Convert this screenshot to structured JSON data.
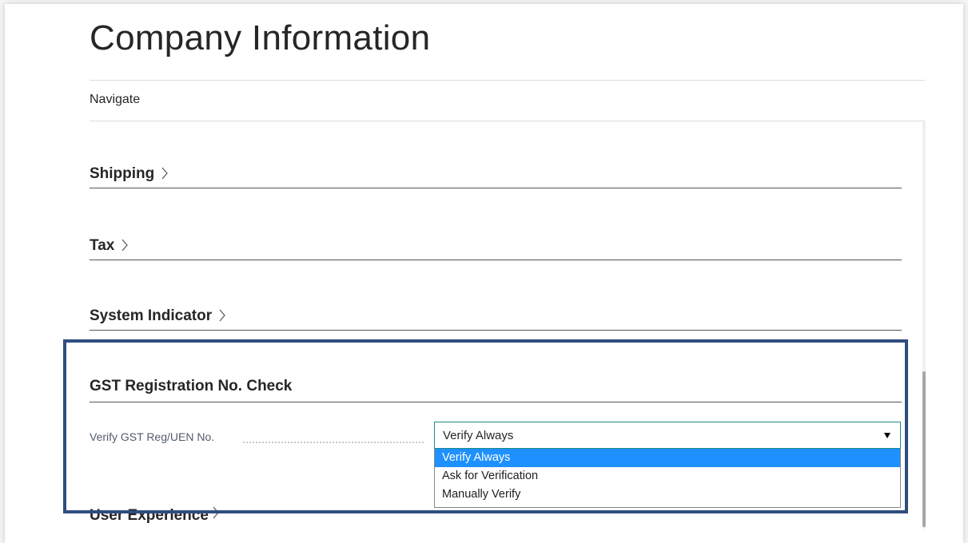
{
  "page": {
    "title": "Company Information"
  },
  "navigation": {
    "navigate_label": "Navigate"
  },
  "fasttabs": [
    {
      "label": "Shipping",
      "icon": "chevron-right-icon"
    },
    {
      "label": "Tax",
      "icon": "chevron-right-icon"
    },
    {
      "label": "System Indicator",
      "icon": "chevron-right-icon"
    }
  ],
  "gst_section": {
    "title": "GST Registration No. Check",
    "field_label": "Verify GST Reg/UEN No.",
    "selected_value": "Verify Always",
    "options": [
      "Verify Always",
      "Ask for Verification",
      "Manually Verify"
    ]
  },
  "user_experience": {
    "label": "User Experience",
    "icon": "chevron-right-icon"
  },
  "colors": {
    "highlight_border": "#2f4d7d",
    "selected_option_bg": "#1e90ff",
    "select_border": "#1a8a8a"
  }
}
